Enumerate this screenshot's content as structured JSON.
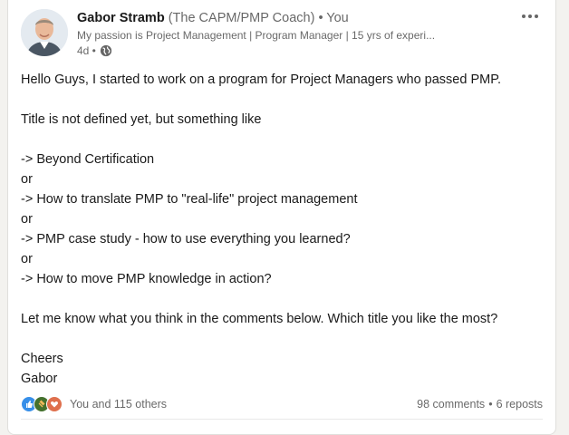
{
  "post": {
    "author": {
      "name": "Gabor Stramb",
      "name_suffix": " (The CAPM/PMP Coach) • You",
      "headline": "My passion is Project Management | Program Manager | 15 yrs of experi...",
      "time": "4d •"
    },
    "body": {
      "lines": [
        "Hello Guys, I started to work on a program for Project Managers who passed PMP.",
        "",
        "Title is not defined yet, but something like",
        "",
        "-> Beyond Certification",
        "or",
        "-> How to translate PMP to \"real-life\" project management",
        "or",
        "-> PMP case study - how to use everything you learned?",
        "or",
        "-> How to move PMP knowledge in action?",
        "",
        "Let me know what you think in the comments below. Which title you like the most?",
        "",
        "Cheers",
        "Gabor"
      ]
    },
    "social": {
      "reactions_text": "You and 115 others",
      "comments": "98 comments",
      "separator": "•",
      "reposts": "6 reposts",
      "reaction_icons": [
        "like-icon",
        "celebrate-icon",
        "love-icon"
      ]
    }
  },
  "colors": {
    "like": "#378fe9",
    "celebrate": "#44712e",
    "love": "#df704d"
  }
}
